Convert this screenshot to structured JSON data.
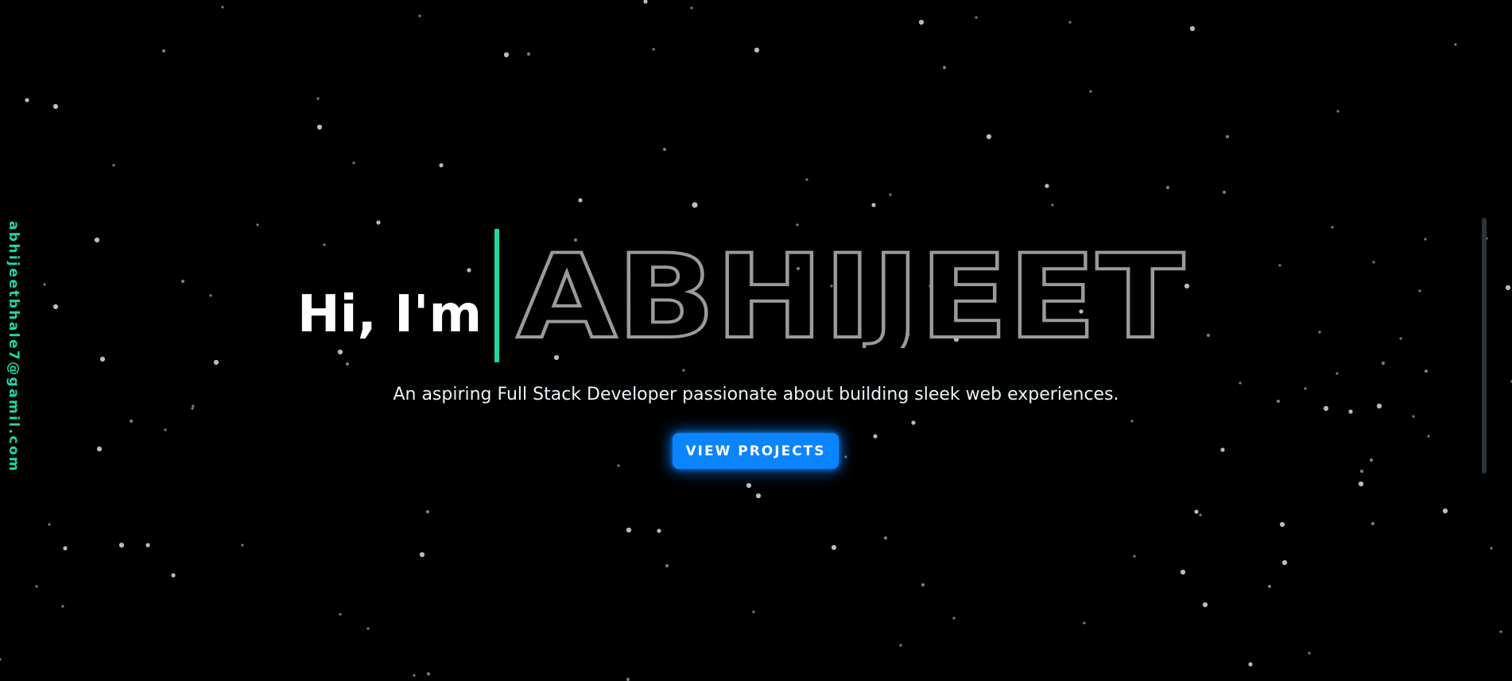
{
  "sidebar": {
    "email": "abhijeetbhale7@gamil.com"
  },
  "hero": {
    "greeting": "Hi, I'm",
    "name": "ABHIJEET",
    "tagline": "An aspiring Full Stack Developer passionate about building sleek web experiences.",
    "cta_label": "VIEW PROJECTS"
  },
  "colors": {
    "background": "#000000",
    "accent": "#1fd8a4",
    "button": "#0a84ff",
    "name_outline": "#9a9a9a",
    "star": "#cfcfcf",
    "scrollbar": "#2c3440"
  }
}
